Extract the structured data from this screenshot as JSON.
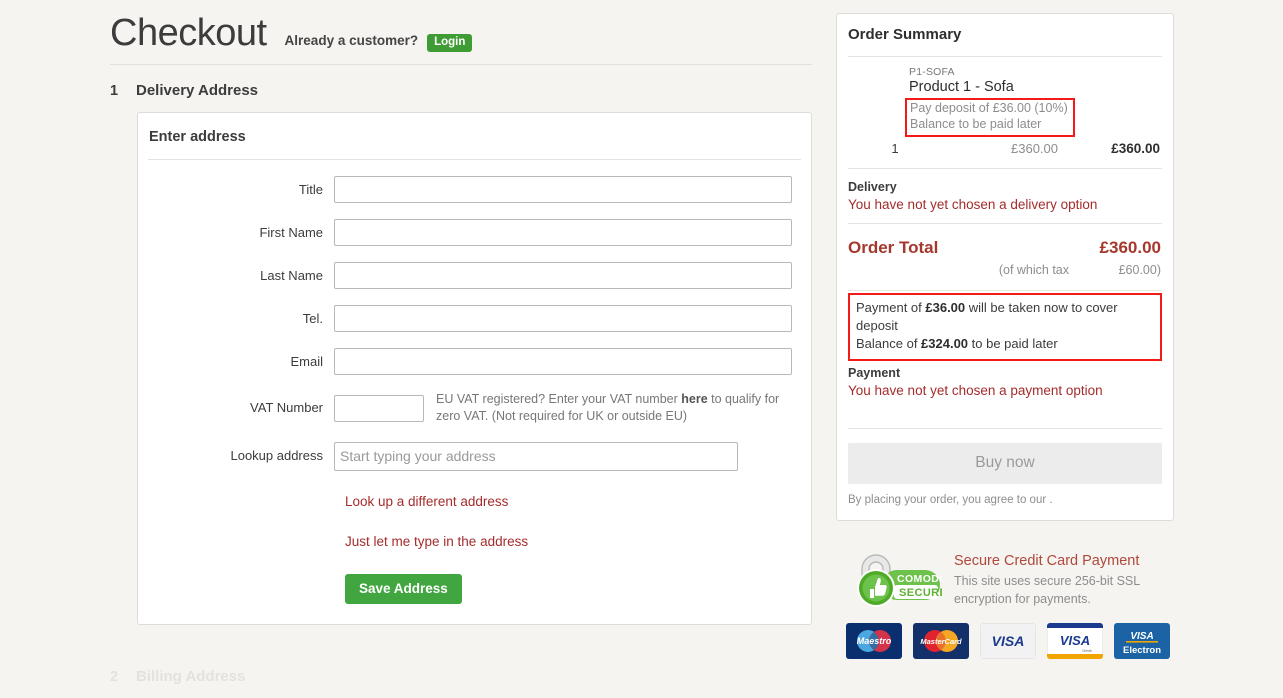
{
  "page": {
    "title": "Checkout",
    "already_customer": "Already a customer?",
    "login_label": "Login"
  },
  "steps": [
    {
      "number": "1",
      "title": "Delivery Address"
    },
    {
      "number": "2",
      "title": "Billing Address"
    }
  ],
  "address_form": {
    "panel_title": "Enter address",
    "fields": [
      {
        "label": "Title",
        "value": "",
        "placeholder": ""
      },
      {
        "label": "First Name",
        "value": "",
        "placeholder": ""
      },
      {
        "label": "Last Name",
        "value": "",
        "placeholder": ""
      },
      {
        "label": "Tel.",
        "value": "",
        "placeholder": ""
      },
      {
        "label": "Email",
        "value": "",
        "placeholder": ""
      }
    ],
    "vat": {
      "label": "VAT Number",
      "value": "",
      "help_before": "EU VAT registered? Enter your VAT number ",
      "help_link": "here",
      "help_after": " to qualify for zero VAT. (Not required for UK or outside EU)"
    },
    "lookup": {
      "label": "Lookup address",
      "value": "",
      "placeholder": "Start typing your address"
    },
    "links": [
      "Look up a different address",
      "Just let me type in the address"
    ],
    "save_label": "Save Address"
  },
  "order_summary": {
    "title": "Order Summary",
    "items": [
      {
        "sku": "P1-SOFA",
        "name": "Product 1 - Sofa",
        "deposit_line1": "Pay deposit of £36.00 (10%)",
        "deposit_line2": "Balance to be paid later",
        "qty": "1",
        "unit_price": "£360.00",
        "line_total": "£360.00"
      }
    ],
    "delivery": {
      "label": "Delivery",
      "value": "You have not yet chosen a delivery option"
    },
    "order_total": {
      "label": "Order Total",
      "amount": "£360.00",
      "tax_label": "(of which tax",
      "tax_amount": "£60.00)"
    },
    "payment_notice": {
      "line1_before": "Payment of ",
      "line1_amount": "£36.00",
      "line1_after": " will be taken now to cover deposit",
      "line2_before": "Balance of ",
      "line2_amount": "£324.00",
      "line2_after": " to be paid later"
    },
    "payment": {
      "label": "Payment",
      "value": "You have not yet chosen a payment option"
    },
    "buy_now_label": "Buy now",
    "terms_note": "By placing your order, you agree to our ."
  },
  "secure": {
    "badge_top": "COMODO",
    "badge_bottom": "SECURE",
    "title": "Secure Credit Card Payment",
    "subtitle": "This site uses secure 256-bit SSL encryption for payments.",
    "cards": [
      "Maestro",
      "MasterCard",
      "VISA",
      "VISA Debit",
      "VISA Electron"
    ]
  },
  "colors": {
    "background": "#f5f4f0",
    "accent_red": "#a62c2c",
    "total_red": "#a5382c",
    "highlight_border": "#f41a1a",
    "green_button": "#41a540",
    "login_green": "#3f9c35"
  }
}
